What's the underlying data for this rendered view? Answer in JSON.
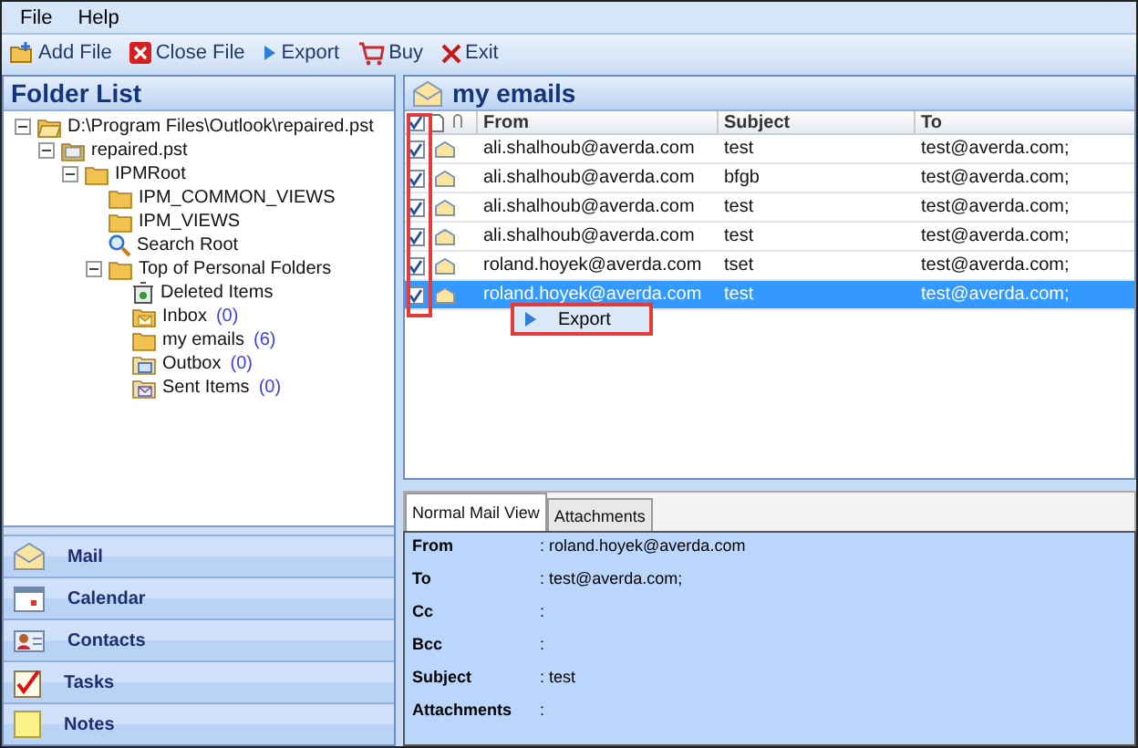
{
  "menu": [
    "File",
    "Help"
  ],
  "toolbar": [
    {
      "kind": "add",
      "label": "Add File"
    },
    {
      "kind": "close",
      "label": "Close File"
    },
    {
      "kind": "export",
      "label": "Export"
    },
    {
      "kind": "buy",
      "label": "Buy"
    },
    {
      "kind": "exit",
      "label": "Exit"
    }
  ],
  "folder_list": {
    "title": "Folder List",
    "tree": [
      {
        "kind": "openfolder",
        "label": "D:\\Program Files\\Outlook\\repaired.pst",
        "expanded": true,
        "children": [
          {
            "kind": "pst",
            "label": "repaired.pst",
            "expanded": true,
            "children": [
              {
                "kind": "folder",
                "label": "IPMRoot",
                "expanded": true,
                "children": [
                  {
                    "kind": "folder",
                    "label": "IPM_COMMON_VIEWS"
                  },
                  {
                    "kind": "folder",
                    "label": "IPM_VIEWS"
                  },
                  {
                    "kind": "search",
                    "label": "Search Root"
                  },
                  {
                    "kind": "folder",
                    "label": "Top of Personal Folders",
                    "expanded": true,
                    "children": [
                      {
                        "kind": "deleted",
                        "label": "Deleted Items"
                      },
                      {
                        "kind": "inbox",
                        "label": "Inbox",
                        "count": "(0)"
                      },
                      {
                        "kind": "folder",
                        "label": "my emails",
                        "count": "(6)"
                      },
                      {
                        "kind": "outbox",
                        "label": "Outbox",
                        "count": "(0)"
                      },
                      {
                        "kind": "sent",
                        "label": "Sent Items",
                        "count": "(0)"
                      }
                    ]
                  }
                ]
              }
            ]
          }
        ]
      }
    ]
  },
  "nav": [
    {
      "kind": "mail",
      "label": "Mail"
    },
    {
      "kind": "calendar",
      "label": "Calendar"
    },
    {
      "kind": "contacts",
      "label": "Contacts"
    },
    {
      "kind": "tasks",
      "label": "Tasks"
    },
    {
      "kind": "notes",
      "label": "Notes"
    }
  ],
  "mail_list": {
    "title": "my emails",
    "all_checked": true,
    "columns": [
      "From",
      "Subject",
      "To"
    ],
    "rows": [
      {
        "checked": true,
        "selected": false,
        "from": "ali.shalhoub@averda.com",
        "subject": "test",
        "to": "test@averda.com;"
      },
      {
        "checked": true,
        "selected": false,
        "from": "ali.shalhoub@averda.com",
        "subject": "bfgb",
        "to": "test@averda.com;"
      },
      {
        "checked": true,
        "selected": false,
        "from": "ali.shalhoub@averda.com",
        "subject": "test",
        "to": "test@averda.com;"
      },
      {
        "checked": true,
        "selected": false,
        "from": "ali.shalhoub@averda.com",
        "subject": "test",
        "to": "test@averda.com;"
      },
      {
        "checked": true,
        "selected": false,
        "from": "roland.hoyek@averda.com",
        "subject": "tset",
        "to": "test@averda.com;"
      },
      {
        "checked": true,
        "selected": true,
        "from": "roland.hoyek@averda.com",
        "subject": "test",
        "to": "test@averda.com;"
      }
    ],
    "context_menu": {
      "label": "Export"
    }
  },
  "preview": {
    "tabs": [
      {
        "label": "Normal Mail View",
        "selected": true
      },
      {
        "label": "Attachments",
        "selected": false
      }
    ],
    "fields": [
      {
        "label": "From",
        "value": ": roland.hoyek@averda.com"
      },
      {
        "label": "To",
        "value": ": test@averda.com;"
      },
      {
        "label": "Cc",
        "value": ":"
      },
      {
        "label": "Bcc",
        "value": ":"
      },
      {
        "label": "Subject",
        "value": ": test"
      },
      {
        "label": "Attachments",
        "value": ":"
      }
    ]
  }
}
